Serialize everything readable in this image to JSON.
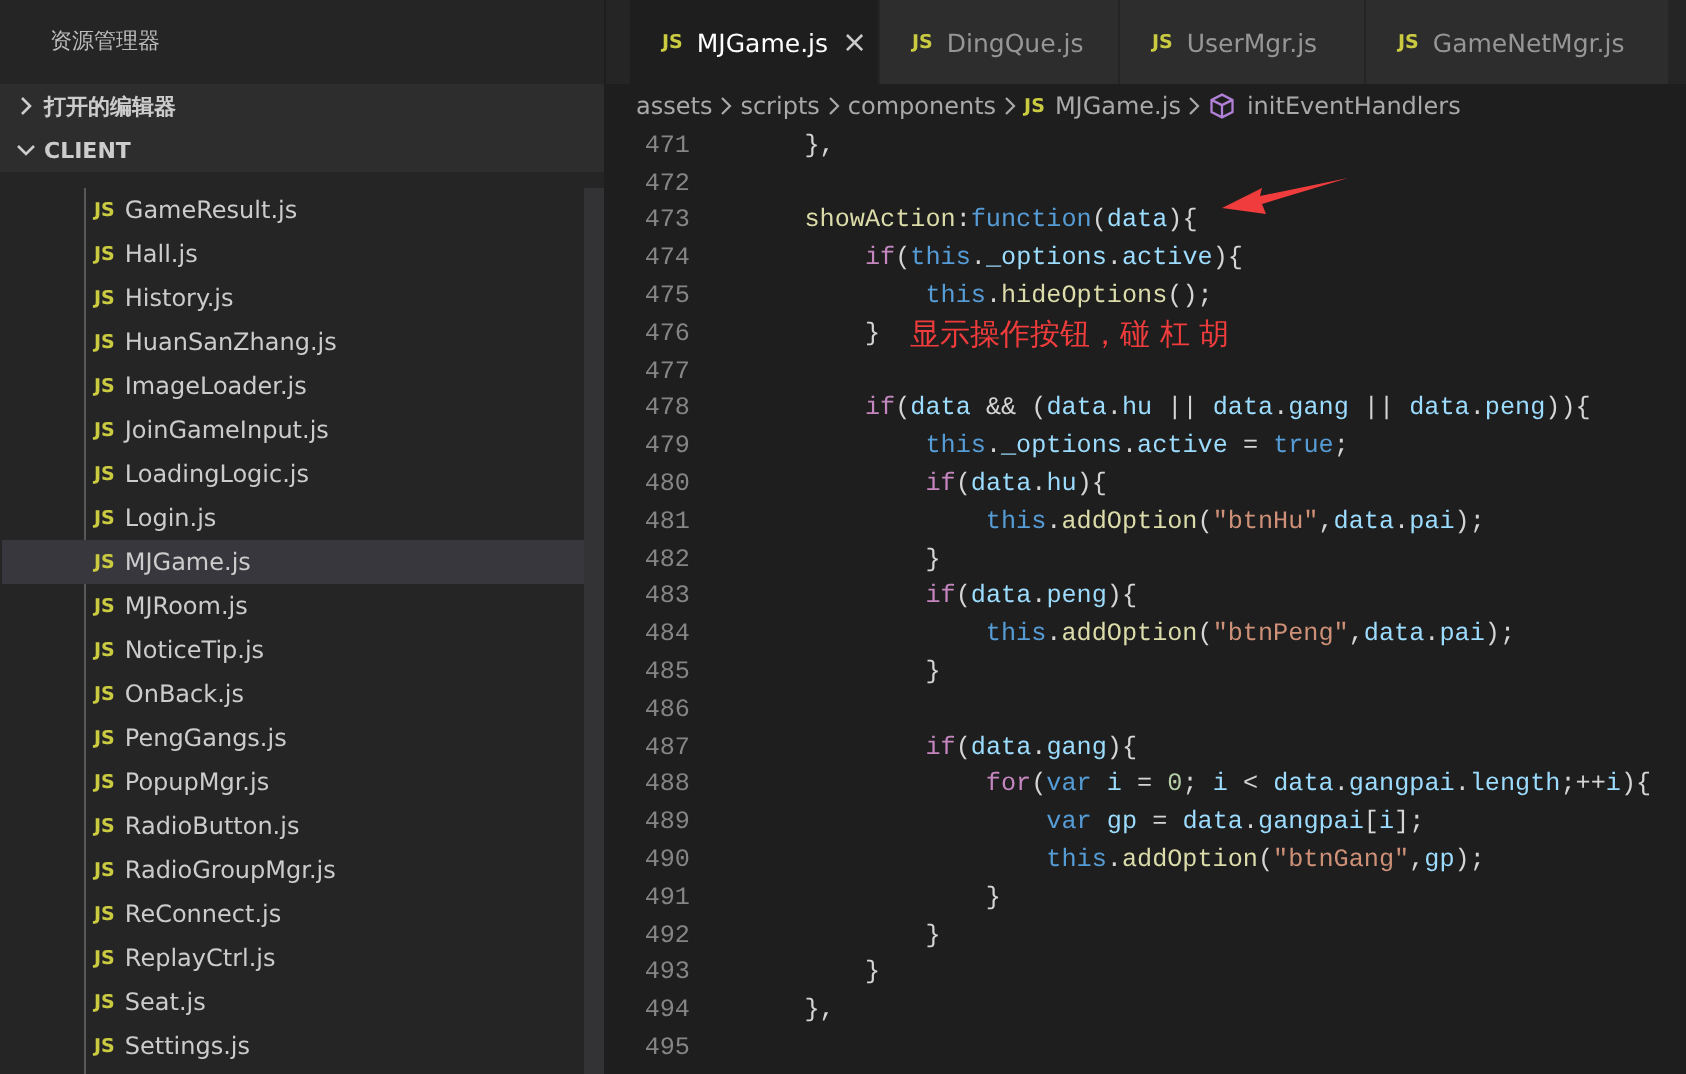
{
  "sidebar": {
    "title": "资源管理器",
    "sections": [
      {
        "label": "打开的编辑器",
        "expanded": false
      },
      {
        "label": "CLIENT",
        "expanded": true
      }
    ],
    "files": [
      {
        "icon": "JS",
        "name": "GameResult.js",
        "selected": false
      },
      {
        "icon": "JS",
        "name": "Hall.js",
        "selected": false
      },
      {
        "icon": "JS",
        "name": "History.js",
        "selected": false
      },
      {
        "icon": "JS",
        "name": "HuanSanZhang.js",
        "selected": false
      },
      {
        "icon": "JS",
        "name": "ImageLoader.js",
        "selected": false
      },
      {
        "icon": "JS",
        "name": "JoinGameInput.js",
        "selected": false
      },
      {
        "icon": "JS",
        "name": "LoadingLogic.js",
        "selected": false
      },
      {
        "icon": "JS",
        "name": "Login.js",
        "selected": false
      },
      {
        "icon": "JS",
        "name": "MJGame.js",
        "selected": true
      },
      {
        "icon": "JS",
        "name": "MJRoom.js",
        "selected": false
      },
      {
        "icon": "JS",
        "name": "NoticeTip.js",
        "selected": false
      },
      {
        "icon": "JS",
        "name": "OnBack.js",
        "selected": false
      },
      {
        "icon": "JS",
        "name": "PengGangs.js",
        "selected": false
      },
      {
        "icon": "JS",
        "name": "PopupMgr.js",
        "selected": false
      },
      {
        "icon": "JS",
        "name": "RadioButton.js",
        "selected": false
      },
      {
        "icon": "JS",
        "name": "RadioGroupMgr.js",
        "selected": false
      },
      {
        "icon": "JS",
        "name": "ReConnect.js",
        "selected": false
      },
      {
        "icon": "JS",
        "name": "ReplayCtrl.js",
        "selected": false
      },
      {
        "icon": "JS",
        "name": "Seat.js",
        "selected": false
      },
      {
        "icon": "JS",
        "name": "Settings.js",
        "selected": false
      }
    ]
  },
  "tabs": [
    {
      "icon": "JS",
      "label": "MJGame.js",
      "selected": true,
      "close": "×"
    },
    {
      "icon": "JS",
      "label": "DingQue.js",
      "selected": false
    },
    {
      "icon": "JS",
      "label": "UserMgr.js",
      "selected": false
    },
    {
      "icon": "JS",
      "label": "GameNetMgr.js",
      "selected": false
    }
  ],
  "breadcrumb": [
    {
      "label": "assets",
      "kind": "folder"
    },
    {
      "label": "scripts",
      "kind": "folder"
    },
    {
      "label": "components",
      "kind": "folder"
    },
    {
      "label": "MJGame.js",
      "kind": "file",
      "icon": "JS"
    },
    {
      "label": "initEventHandlers",
      "kind": "method"
    }
  ],
  "code": [
    {
      "n": "471",
      "tokens": [
        {
          "kind": "p",
          "text": "    },"
        }
      ]
    },
    {
      "n": "472"
    },
    {
      "n": "473",
      "tokens": [
        {
          "kind": "fn",
          "text": "    showAction"
        },
        {
          "kind": "p",
          "text": ":"
        },
        {
          "kind": "kw",
          "text": "function"
        },
        {
          "kind": "p",
          "text": "("
        },
        {
          "kind": "v",
          "text": "data"
        },
        {
          "kind": "p",
          "text": "){"
        }
      ]
    },
    {
      "n": "474",
      "tokens": [
        {
          "kind": "ctl",
          "text": "        if"
        },
        {
          "kind": "p",
          "text": "("
        },
        {
          "kind": "kw",
          "text": "this"
        },
        {
          "kind": "p",
          "text": "."
        },
        {
          "kind": "v",
          "text": "_options"
        },
        {
          "kind": "p",
          "text": "."
        },
        {
          "kind": "v",
          "text": "active"
        },
        {
          "kind": "p",
          "text": "){"
        }
      ]
    },
    {
      "n": "475",
      "tokens": [
        {
          "kind": "kw",
          "text": "            this"
        },
        {
          "kind": "p",
          "text": "."
        },
        {
          "kind": "fn",
          "text": "hideOptions"
        },
        {
          "kind": "p",
          "text": "();"
        }
      ]
    },
    {
      "n": "476",
      "tokens": [
        {
          "kind": "p",
          "text": "        }"
        }
      ]
    },
    {
      "n": "477"
    },
    {
      "n": "478",
      "tokens": [
        {
          "kind": "ctl",
          "text": "        if"
        },
        {
          "kind": "p",
          "text": "("
        },
        {
          "kind": "v",
          "text": "data"
        },
        {
          "kind": "p",
          "text": " && ("
        },
        {
          "kind": "v",
          "text": "data"
        },
        {
          "kind": "p",
          "text": "."
        },
        {
          "kind": "v",
          "text": "hu"
        },
        {
          "kind": "p",
          "text": " || "
        },
        {
          "kind": "v",
          "text": "data"
        },
        {
          "kind": "p",
          "text": "."
        },
        {
          "kind": "v",
          "text": "gang"
        },
        {
          "kind": "p",
          "text": " || "
        },
        {
          "kind": "v",
          "text": "data"
        },
        {
          "kind": "p",
          "text": "."
        },
        {
          "kind": "v",
          "text": "peng"
        },
        {
          "kind": "p",
          "text": ")){"
        }
      ]
    },
    {
      "n": "479",
      "tokens": [
        {
          "kind": "kw",
          "text": "            this"
        },
        {
          "kind": "p",
          "text": "."
        },
        {
          "kind": "v",
          "text": "_options"
        },
        {
          "kind": "p",
          "text": "."
        },
        {
          "kind": "v",
          "text": "active"
        },
        {
          "kind": "p",
          "text": " = "
        },
        {
          "kind": "kw",
          "text": "true"
        },
        {
          "kind": "p",
          "text": ";"
        }
      ]
    },
    {
      "n": "480",
      "tokens": [
        {
          "kind": "ctl",
          "text": "            if"
        },
        {
          "kind": "p",
          "text": "("
        },
        {
          "kind": "v",
          "text": "data"
        },
        {
          "kind": "p",
          "text": "."
        },
        {
          "kind": "v",
          "text": "hu"
        },
        {
          "kind": "p",
          "text": "){"
        }
      ]
    },
    {
      "n": "481",
      "tokens": [
        {
          "kind": "kw",
          "text": "                this"
        },
        {
          "kind": "p",
          "text": "."
        },
        {
          "kind": "fn",
          "text": "addOption"
        },
        {
          "kind": "p",
          "text": "("
        },
        {
          "kind": "s",
          "text": "\"btnHu\""
        },
        {
          "kind": "p",
          "text": ","
        },
        {
          "kind": "v",
          "text": "data"
        },
        {
          "kind": "p",
          "text": "."
        },
        {
          "kind": "v",
          "text": "pai"
        },
        {
          "kind": "p",
          "text": ");"
        }
      ]
    },
    {
      "n": "482",
      "tokens": [
        {
          "kind": "p",
          "text": "            }"
        }
      ]
    },
    {
      "n": "483",
      "tokens": [
        {
          "kind": "ctl",
          "text": "            if"
        },
        {
          "kind": "p",
          "text": "("
        },
        {
          "kind": "v",
          "text": "data"
        },
        {
          "kind": "p",
          "text": "."
        },
        {
          "kind": "v",
          "text": "peng"
        },
        {
          "kind": "p",
          "text": "){"
        }
      ]
    },
    {
      "n": "484",
      "tokens": [
        {
          "kind": "kw",
          "text": "                this"
        },
        {
          "kind": "p",
          "text": "."
        },
        {
          "kind": "fn",
          "text": "addOption"
        },
        {
          "kind": "p",
          "text": "("
        },
        {
          "kind": "s",
          "text": "\"btnPeng\""
        },
        {
          "kind": "p",
          "text": ","
        },
        {
          "kind": "v",
          "text": "data"
        },
        {
          "kind": "p",
          "text": "."
        },
        {
          "kind": "v",
          "text": "pai"
        },
        {
          "kind": "p",
          "text": ");"
        }
      ]
    },
    {
      "n": "485",
      "tokens": [
        {
          "kind": "p",
          "text": "            }"
        }
      ]
    },
    {
      "n": "486"
    },
    {
      "n": "487",
      "tokens": [
        {
          "kind": "ctl",
          "text": "            if"
        },
        {
          "kind": "p",
          "text": "("
        },
        {
          "kind": "v",
          "text": "data"
        },
        {
          "kind": "p",
          "text": "."
        },
        {
          "kind": "v",
          "text": "gang"
        },
        {
          "kind": "p",
          "text": "){"
        }
      ]
    },
    {
      "n": "488",
      "tokens": [
        {
          "kind": "ctl",
          "text": "                for"
        },
        {
          "kind": "p",
          "text": "("
        },
        {
          "kind": "kw",
          "text": "var"
        },
        {
          "kind": "v",
          "text": " i"
        },
        {
          "kind": "p",
          "text": " = "
        },
        {
          "kind": "num",
          "text": "0"
        },
        {
          "kind": "p",
          "text": "; "
        },
        {
          "kind": "v",
          "text": "i"
        },
        {
          "kind": "p",
          "text": " < "
        },
        {
          "kind": "v",
          "text": "data"
        },
        {
          "kind": "p",
          "text": "."
        },
        {
          "kind": "v",
          "text": "gangpai"
        },
        {
          "kind": "p",
          "text": "."
        },
        {
          "kind": "v",
          "text": "length"
        },
        {
          "kind": "p",
          "text": ";++"
        },
        {
          "kind": "v",
          "text": "i"
        },
        {
          "kind": "p",
          "text": "){"
        }
      ]
    },
    {
      "n": "489",
      "tokens": [
        {
          "kind": "kw",
          "text": "                    var"
        },
        {
          "kind": "v",
          "text": " gp"
        },
        {
          "kind": "p",
          "text": " = "
        },
        {
          "kind": "v",
          "text": "data"
        },
        {
          "kind": "p",
          "text": "."
        },
        {
          "kind": "v",
          "text": "gangpai"
        },
        {
          "kind": "p",
          "text": "["
        },
        {
          "kind": "v",
          "text": "i"
        },
        {
          "kind": "p",
          "text": "];"
        }
      ]
    },
    {
      "n": "490",
      "tokens": [
        {
          "kind": "kw",
          "text": "                    this"
        },
        {
          "kind": "p",
          "text": "."
        },
        {
          "kind": "fn",
          "text": "addOption"
        },
        {
          "kind": "p",
          "text": "("
        },
        {
          "kind": "s",
          "text": "\"btnGang\""
        },
        {
          "kind": "p",
          "text": ","
        },
        {
          "kind": "v",
          "text": "gp"
        },
        {
          "kind": "p",
          "text": ");"
        }
      ]
    },
    {
      "n": "491",
      "tokens": [
        {
          "kind": "p",
          "text": "                }"
        }
      ]
    },
    {
      "n": "492",
      "tokens": [
        {
          "kind": "p",
          "text": "            }"
        }
      ]
    },
    {
      "n": "493",
      "tokens": [
        {
          "kind": "p",
          "text": "        }"
        }
      ]
    },
    {
      "n": "494",
      "tokens": [
        {
          "kind": "p",
          "text": "    },"
        }
      ]
    },
    {
      "n": "495"
    }
  ],
  "annotation": {
    "text": "显示操作按钮，碰 杠 胡",
    "color": "#f03c3c"
  }
}
